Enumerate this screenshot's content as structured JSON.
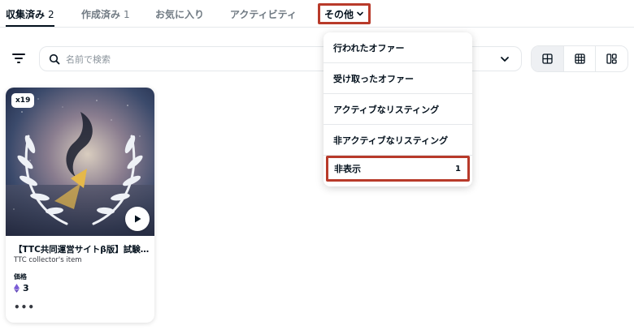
{
  "tabs": [
    {
      "label": "収集済み",
      "count": "2",
      "active": true
    },
    {
      "label": "作成済み",
      "count": "1",
      "active": false
    },
    {
      "label": "お気に入り",
      "count": "",
      "active": false
    },
    {
      "label": "アクティビティ",
      "count": "",
      "active": false
    }
  ],
  "more_tab": {
    "label": "その他",
    "icon": "chevron-down-icon"
  },
  "toolbar": {
    "filter_icon": "filter-icon",
    "search_placeholder": "名前で検索",
    "sort_icon": "chevron-down-icon",
    "views": [
      {
        "icon": "grid-large-icon",
        "selected": true
      },
      {
        "icon": "grid-small-icon",
        "selected": false
      },
      {
        "icon": "masonry-icon",
        "selected": false
      }
    ]
  },
  "dropdown": {
    "items": [
      {
        "label": "行われたオファー",
        "badge": ""
      },
      {
        "label": "受け取ったオファー",
        "badge": ""
      },
      {
        "label": "アクティブなリスティング",
        "badge": ""
      },
      {
        "label": "非アクティブなリスティング",
        "badge": ""
      },
      {
        "label": "非表示",
        "badge": "1"
      }
    ]
  },
  "card": {
    "quantity": "x19",
    "title": "【TTC共同運営サイトβ版】試験運用記念",
    "collection": "TTC collector's item",
    "price_label": "価格",
    "price": "3",
    "currency_icon": "ethereum-icon",
    "more": "•••"
  },
  "colors": {
    "highlight_border": "#b83a2a",
    "text_primary": "#04111d",
    "text_secondary": "#707a83",
    "eth_purple": "#7b5dd6"
  }
}
